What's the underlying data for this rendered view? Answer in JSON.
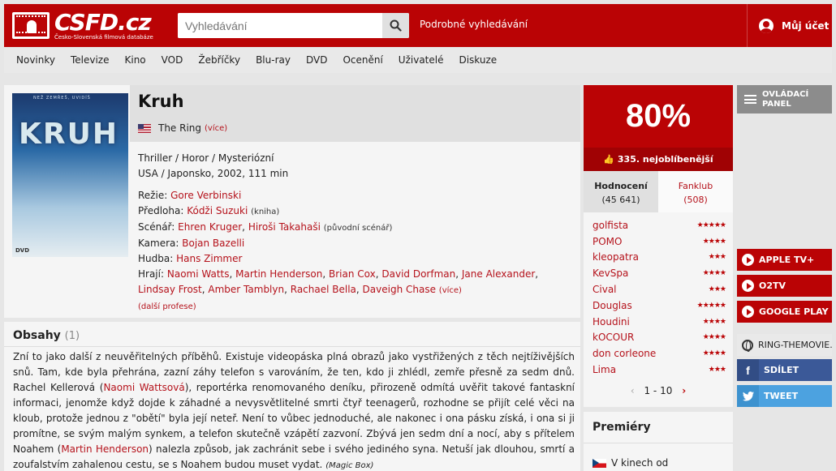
{
  "header": {
    "logo_text": "CSFD.cz",
    "logo_tagline": "Česko-Slovenská filmová databáze",
    "search_placeholder": "Vyhledávání",
    "advanced_search": "Podrobné vyhledávání",
    "account": "Můj účet"
  },
  "nav": [
    "Novinky",
    "Televize",
    "Kino",
    "VOD",
    "Žebříčky",
    "Blu-ray",
    "DVD",
    "Ocenění",
    "Uživatelé",
    "Diskuze"
  ],
  "film": {
    "title": "Kruh",
    "original_title": "The Ring",
    "original_more": "(více)",
    "poster_title": "KRUH",
    "poster_tagline": "NEŽ ZEMŘEŠ, UVIDÍŠ",
    "poster_badge": "DVD",
    "genres": "Thriller / Horor / Mysteriózní",
    "origin": "USA / Japonsko, 2002, 111 min",
    "credits": {
      "directing_label": "Režie:",
      "directing": [
        "Gore Verbinski"
      ],
      "source_label": "Předloha:",
      "source": [
        "Kódži Suzuki"
      ],
      "source_note": "(kniha)",
      "script_label": "Scénář:",
      "script": [
        "Ehren Kruger",
        "Hiroši Takahaši"
      ],
      "script_note": "(původní scénář)",
      "camera_label": "Kamera:",
      "camera": [
        "Bojan Bazelli"
      ],
      "music_label": "Hudba:",
      "music": [
        "Hans Zimmer"
      ],
      "cast_label": "Hrají:",
      "cast": [
        "Naomi Watts",
        "Martin Henderson",
        "Brian Cox",
        "David Dorfman",
        "Jane Alexander",
        "Lindsay Frost",
        "Amber Tamblyn",
        "Rachael Bella",
        "Daveigh Chase"
      ],
      "cast_more": "(více)",
      "more_professions": "(další profese)"
    }
  },
  "plot": {
    "heading": "Obsahy",
    "count": "(1)",
    "text_1": "Zní to jako další z neuvěřitelných příběhů. Existuje videopáska plná obrazů jako vystřižených z těch nejtíživějších snů. Tam, kde byla přehrána, zazní záhy telefon s varováním, že ten, kdo ji zhlédl, zemře přesně za sedm dnů. Rachel Kellerová (",
    "actor_1": "Naomi Wattsová",
    "text_2": "), reportérka renomovaného deníku, přirozeně odmítá uvěřit takové fantaskní informaci, jenomže když dojde k záhadné a nevysvětlitelné smrti čtyř teenagerů, rozhodne se přijít celé věci na kloub, protože jednou z \"obětí\" byla její neteř. Není to vůbec jednoduché, ale nakonec i ona pásku získá, i ona si ji promítne, se svým malým synkem, a telefon skutečně vzápětí zazvoní. Zbývá jen sedm dní a nocí, aby s přítelem Noahem (",
    "actor_2": "Martin Henderson",
    "text_3": ") nalezla způsob, jak zachránit sebe i svého jediného syna. Netuší jak dlouhou, smrtí a zoufalstvím zahalenou cestu, se s Noahem budou muset vydat.",
    "source": "(Magic Box)"
  },
  "rating": {
    "score": "80%",
    "rank": "335. nejoblíbenější",
    "tab_ratings": "Hodnocení",
    "tab_ratings_count": "(45 641)",
    "tab_fanclub": "Fanklub",
    "tab_fanclub_count": "(508)",
    "users": [
      {
        "name": "golfista",
        "stars": "★★★★★"
      },
      {
        "name": "POMO",
        "stars": "★★★★"
      },
      {
        "name": "kleopatra",
        "stars": "★★★"
      },
      {
        "name": "KevSpa",
        "stars": "★★★★"
      },
      {
        "name": "Cival",
        "stars": "★★★"
      },
      {
        "name": "Douglas",
        "stars": "★★★★★"
      },
      {
        "name": "Houdini",
        "stars": "★★★★"
      },
      {
        "name": "kOCOUR",
        "stars": "★★★★"
      },
      {
        "name": "don corleone",
        "stars": "★★★★"
      },
      {
        "name": "Lima",
        "stars": "★★★"
      }
    ],
    "pager": "1 - 10"
  },
  "premieres": {
    "heading": "Premiéry",
    "item": "V kinech od"
  },
  "sidebar": {
    "control_panel": "OVLÁDACÍ PANEL",
    "vod": [
      "APPLE TV+",
      "O2TV",
      "GOOGLE PLAY"
    ],
    "website": "RING-THEMOVIE.COM",
    "share": "SDÍLET",
    "tweet": "TWEET"
  }
}
